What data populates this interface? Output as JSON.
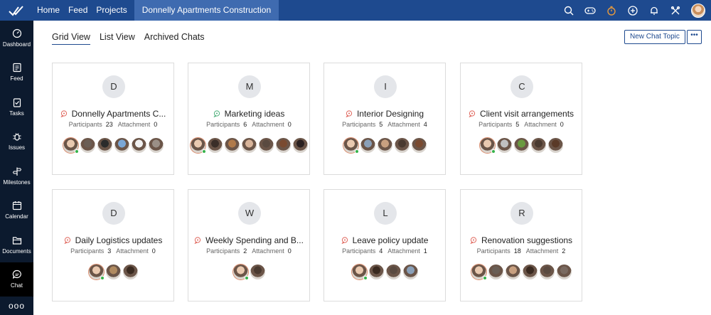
{
  "topbar": {
    "nav": [
      "Home",
      "Feed",
      "Projects"
    ],
    "active_project": "Donnelly Apartments Construction",
    "icons": [
      "search-icon",
      "gamepad-icon",
      "timer-icon",
      "add-circle-icon",
      "bell-icon",
      "tools-icon"
    ]
  },
  "sidebar": {
    "items": [
      {
        "label": "Dashboard",
        "icon": "speedometer-icon"
      },
      {
        "label": "Feed",
        "icon": "feed-icon"
      },
      {
        "label": "Tasks",
        "icon": "clipboard-check-icon"
      },
      {
        "label": "Issues",
        "icon": "bug-icon"
      },
      {
        "label": "Milestones",
        "icon": "signpost-icon"
      },
      {
        "label": "Calendar",
        "icon": "calendar-icon"
      },
      {
        "label": "Documents",
        "icon": "folder-icon"
      },
      {
        "label": "Chat",
        "icon": "chat-icon"
      }
    ],
    "more": "ooo"
  },
  "views": {
    "tabs": [
      "Grid View",
      "List View",
      "Archived Chats"
    ],
    "active": 0
  },
  "actions": {
    "new_topic": "New Chat Topic",
    "more": "•••"
  },
  "labels": {
    "participants": "Participants",
    "attachment": "Attachment"
  },
  "chats": [
    {
      "letter": "D",
      "title": "Donnelly Apartments C...",
      "participants": "23",
      "attachment": "0",
      "avatars": [
        "#e9c9b0",
        "#6a5e55",
        "#2b2b2b",
        "#7aa7d6",
        "#f2f2f2",
        "#9a8f86"
      ],
      "icon_color": "#e0665c"
    },
    {
      "letter": "M",
      "title": "Marketing ideas",
      "participants": "6",
      "attachment": "0",
      "avatars": [
        "#e9c9b0",
        "#3a2e28",
        "#b07a4a",
        "#d8b49a",
        "#5a4a40",
        "#7a4a30",
        "#2a2020"
      ],
      "icon_color": "#4caf7a"
    },
    {
      "letter": "I",
      "title": "Interior Designing",
      "participants": "5",
      "attachment": "4",
      "avatars": [
        "#e9c9b0",
        "#8aa0b8",
        "#c8a080",
        "#4a3a30",
        "#7a4a30"
      ],
      "icon_color": "#e0665c"
    },
    {
      "letter": "C",
      "title": "Client visit arrangements",
      "participants": "5",
      "attachment": "0",
      "avatars": [
        "#e9c9b0",
        "#c0c0c0",
        "#6a9a40",
        "#4a3a30",
        "#5a3a28"
      ],
      "icon_color": "#e0665c"
    },
    {
      "letter": "D",
      "title": "Daily Logistics updates",
      "participants": "3",
      "attachment": "0",
      "avatars": [
        "#e9c9b0",
        "#b08a60",
        "#3a2a20"
      ],
      "icon_color": "#e0665c"
    },
    {
      "letter": "W",
      "title": "Weekly Spending and B...",
      "participants": "2",
      "attachment": "0",
      "avatars": [
        "#e9c9b0",
        "#4a3a30"
      ],
      "icon_color": "#e0665c"
    },
    {
      "letter": "L",
      "title": "Leave policy update",
      "participants": "4",
      "attachment": "1",
      "avatars": [
        "#e9c9b0",
        "#3a2a20",
        "#5a4a40",
        "#8aa0b8"
      ],
      "icon_color": "#e0665c"
    },
    {
      "letter": "R",
      "title": "Renovation suggestions",
      "participants": "18",
      "attachment": "2",
      "avatars": [
        "#e9c9b0",
        "#6a5e55",
        "#c8a080",
        "#3a2a20",
        "#5a4a40",
        "#7a6a60"
      ],
      "icon_color": "#e0665c"
    }
  ]
}
